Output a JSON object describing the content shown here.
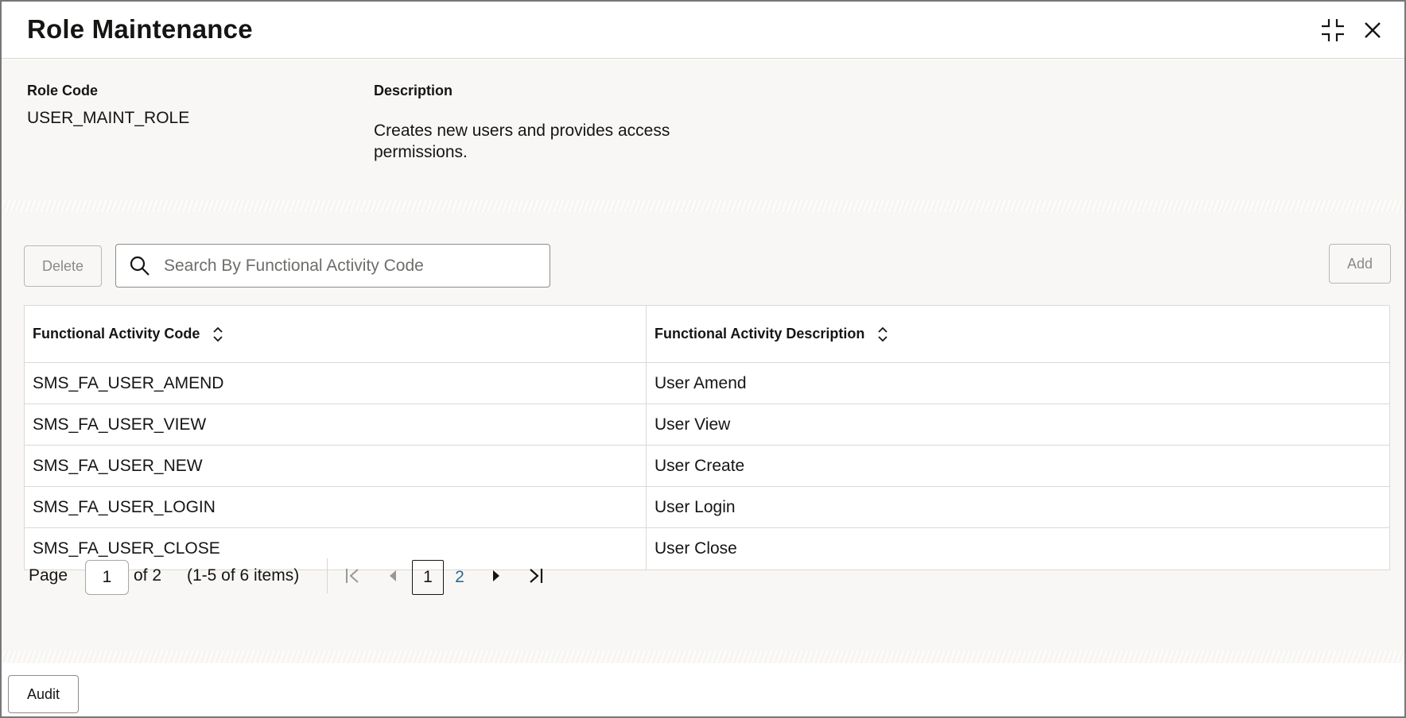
{
  "window": {
    "title": "Role Maintenance",
    "minimize_icon": "minimize-arrows-icon",
    "close_icon": "close-icon"
  },
  "role": {
    "code_label": "Role Code",
    "code_value": "USER_MAINT_ROLE",
    "description_label": "Description",
    "description_line1": "Creates new users and provides access",
    "description_line2": "permissions."
  },
  "toolbar": {
    "delete_label": "Delete",
    "add_label": "Add",
    "search_placeholder": "Search By Functional Activity Code",
    "search_value": ""
  },
  "table": {
    "columns": [
      "Functional Activity Code",
      "Functional Activity Description"
    ],
    "rows": [
      [
        "SMS_FA_USER_AMEND",
        "User Amend"
      ],
      [
        "SMS_FA_USER_VIEW",
        "User View"
      ],
      [
        "SMS_FA_USER_NEW",
        "User Create"
      ],
      [
        "SMS_FA_USER_LOGIN",
        "User Login"
      ],
      [
        "SMS_FA_USER_CLOSE",
        "User Close"
      ]
    ]
  },
  "pagination": {
    "page_label": "Page",
    "current_page": "1",
    "of_label": "of 2",
    "range_text": "(1-5 of 6 items)",
    "pages": [
      "1",
      "2"
    ]
  },
  "footer": {
    "audit_label": "Audit"
  },
  "colors": {
    "panel_bg": "#f8f7f5",
    "border": "#dcd9d5",
    "link": "#2f6b8f",
    "text": "#161513"
  }
}
